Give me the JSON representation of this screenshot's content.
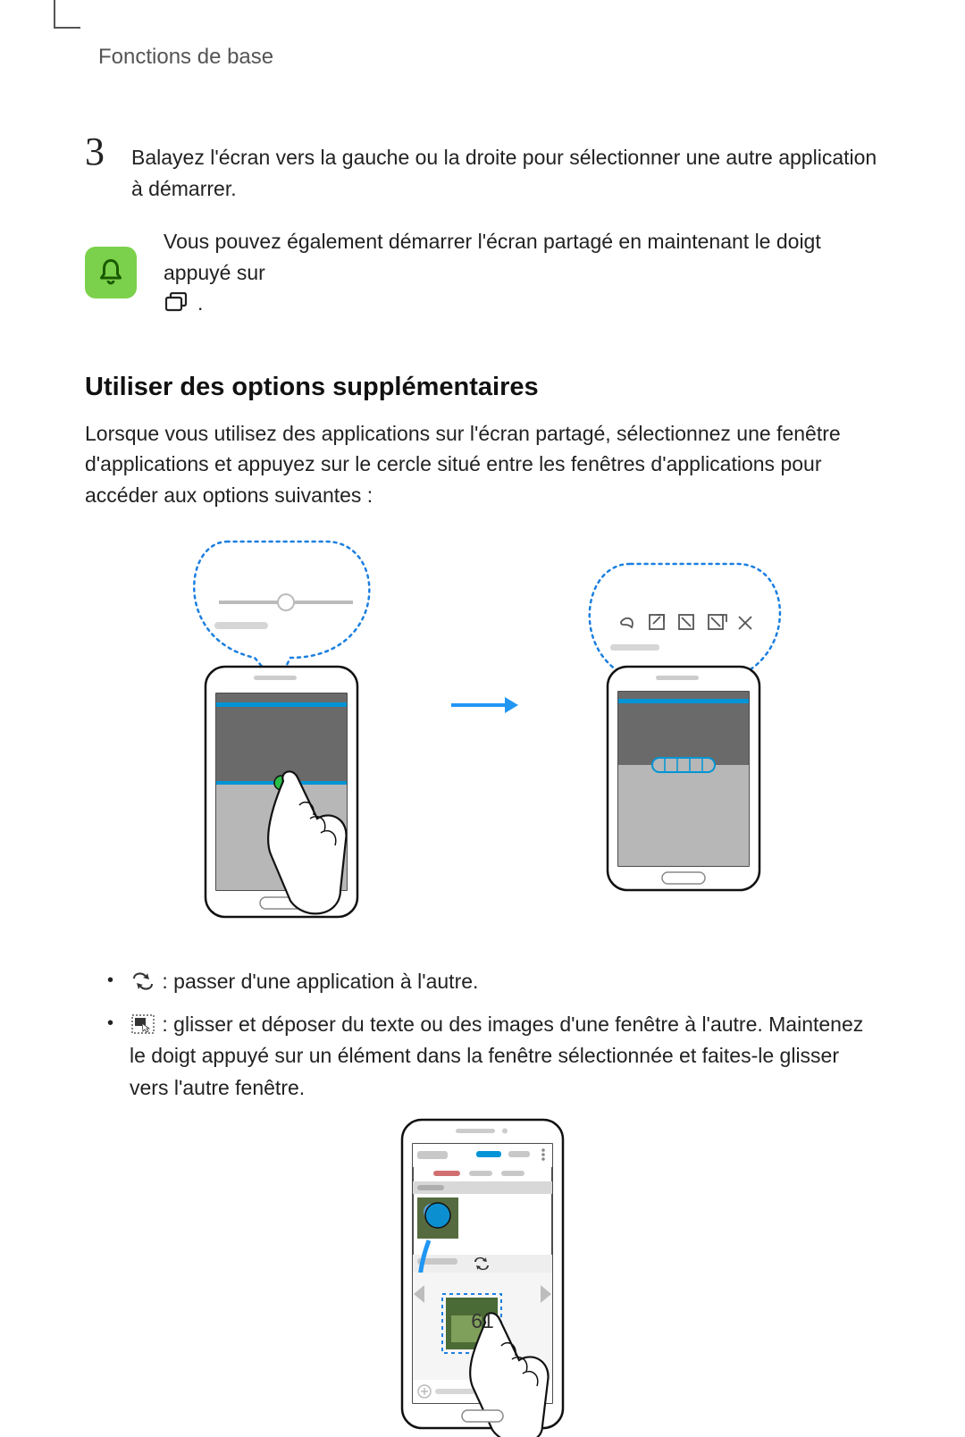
{
  "chapter": "Fonctions de base",
  "step": {
    "number": "3",
    "text": "Balayez l'écran vers la gauche ou la droite pour sélectionner une autre application à démarrer."
  },
  "note": {
    "text_before": "Vous pouvez également démarrer l'écran partagé en maintenant le doigt appuyé sur",
    "text_after": "."
  },
  "section_heading": "Utiliser des options supplémentaires",
  "section_intro": "Lorsque vous utilisez des applications sur l'écran partagé, sélectionnez une fenêtre d'applications et appuyez sur le cercle situé entre les fenêtres d'applications pour accéder aux options suivantes :",
  "bullet1": " : passer d'une application à l'autre.",
  "bullet2": " : glisser et déposer du texte ou des images d'une fenêtre à l'autre. Maintenez le doigt appuyé sur un élément dans la fenêtre sélectionnée et faites-le glisser vers l'autre fenêtre.",
  "page_number": "61"
}
